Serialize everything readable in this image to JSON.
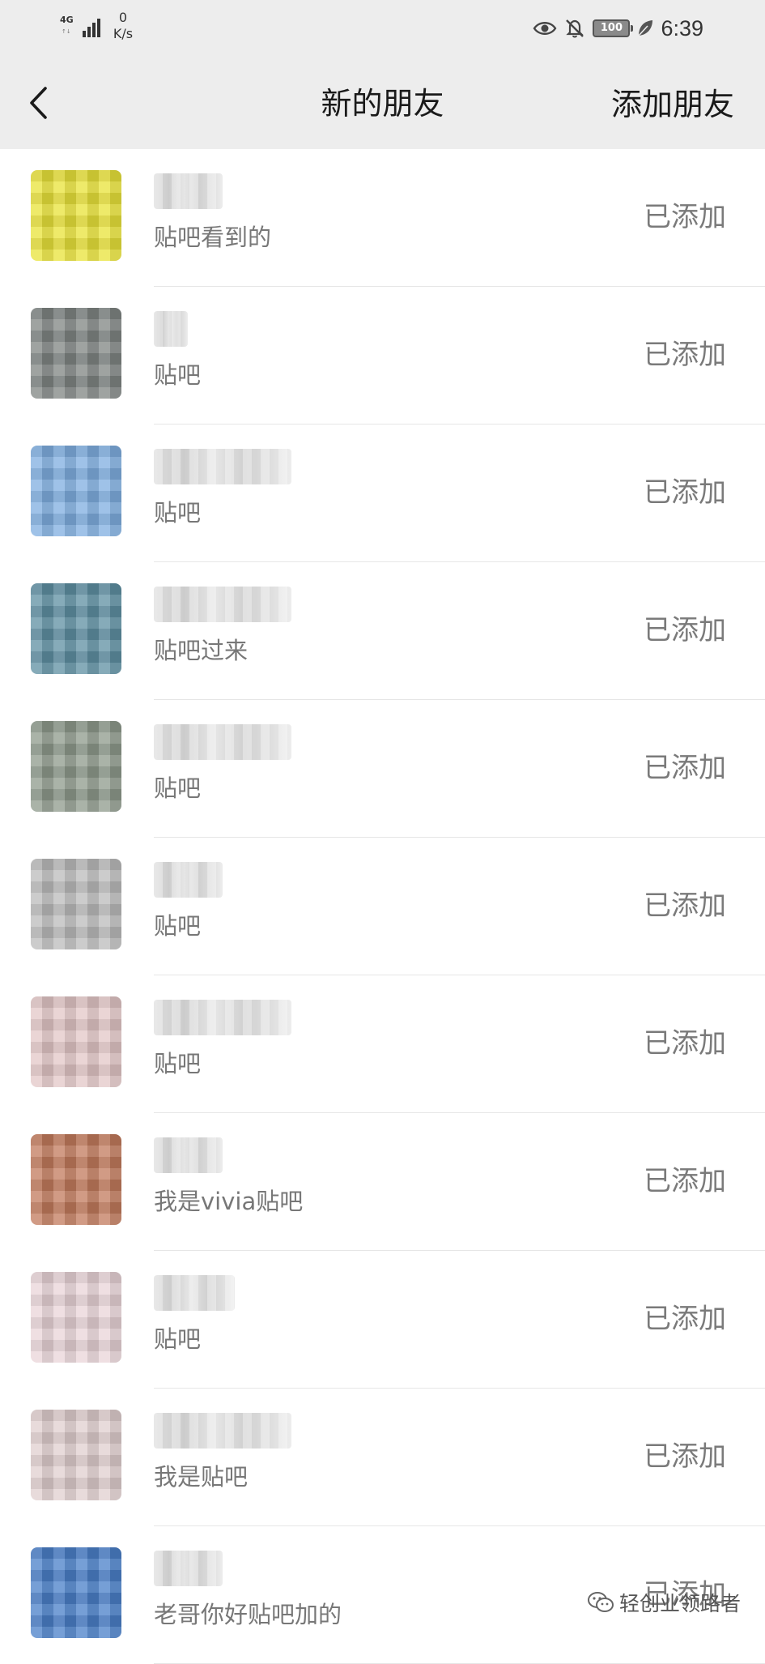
{
  "status_bar": {
    "network": "4G",
    "speed_value": "0",
    "speed_unit": "K/s",
    "icons": [
      "eye-icon",
      "bell-off-icon",
      "battery-icon",
      "leaf-icon"
    ],
    "battery": "100",
    "time": "6:39"
  },
  "nav": {
    "back_icon": "chevron-left-icon",
    "title": "新的朋友",
    "action": "添加朋友"
  },
  "friends": [
    {
      "note": "贴吧看到的",
      "status": "已添加",
      "avatar_color": "#e8e23a",
      "name_blur_width": "85"
    },
    {
      "note": "贴吧",
      "status": "已添加",
      "avatar_color": "#7f8583",
      "name_blur_width": "42"
    },
    {
      "note": "贴吧",
      "status": "已添加",
      "avatar_color": "#7faee0",
      "name_blur_width": "170"
    },
    {
      "note": "贴吧过来",
      "status": "已添加",
      "avatar_color": "#5f8fa3",
      "name_blur_width": "170"
    },
    {
      "note": "贴吧",
      "status": "已添加",
      "avatar_color": "#8e9a8c",
      "name_blur_width": "170"
    },
    {
      "note": "贴吧",
      "status": "已添加",
      "avatar_color": "#bcbcbc",
      "name_blur_width": "85"
    },
    {
      "note": "贴吧",
      "status": "已添加",
      "avatar_color": "#e3c7c7",
      "name_blur_width": "170"
    },
    {
      "note": "我是vivia贴吧",
      "status": "已添加",
      "avatar_color": "#c27b5d",
      "name_blur_width": "85"
    },
    {
      "note": "贴吧",
      "status": "已添加",
      "avatar_color": "#e9d5d8",
      "name_blur_width": "100"
    },
    {
      "note": "我是贴吧",
      "status": "已添加",
      "avatar_color": "#e0cfcf",
      "name_blur_width": "170"
    },
    {
      "note": "老哥你好贴吧加的",
      "status": "已添加",
      "avatar_color": "#4a7fc8",
      "name_blur_width": "85"
    }
  ],
  "watermark": {
    "icon": "wechat-official-account-icon",
    "text": "轻创业领路者"
  }
}
